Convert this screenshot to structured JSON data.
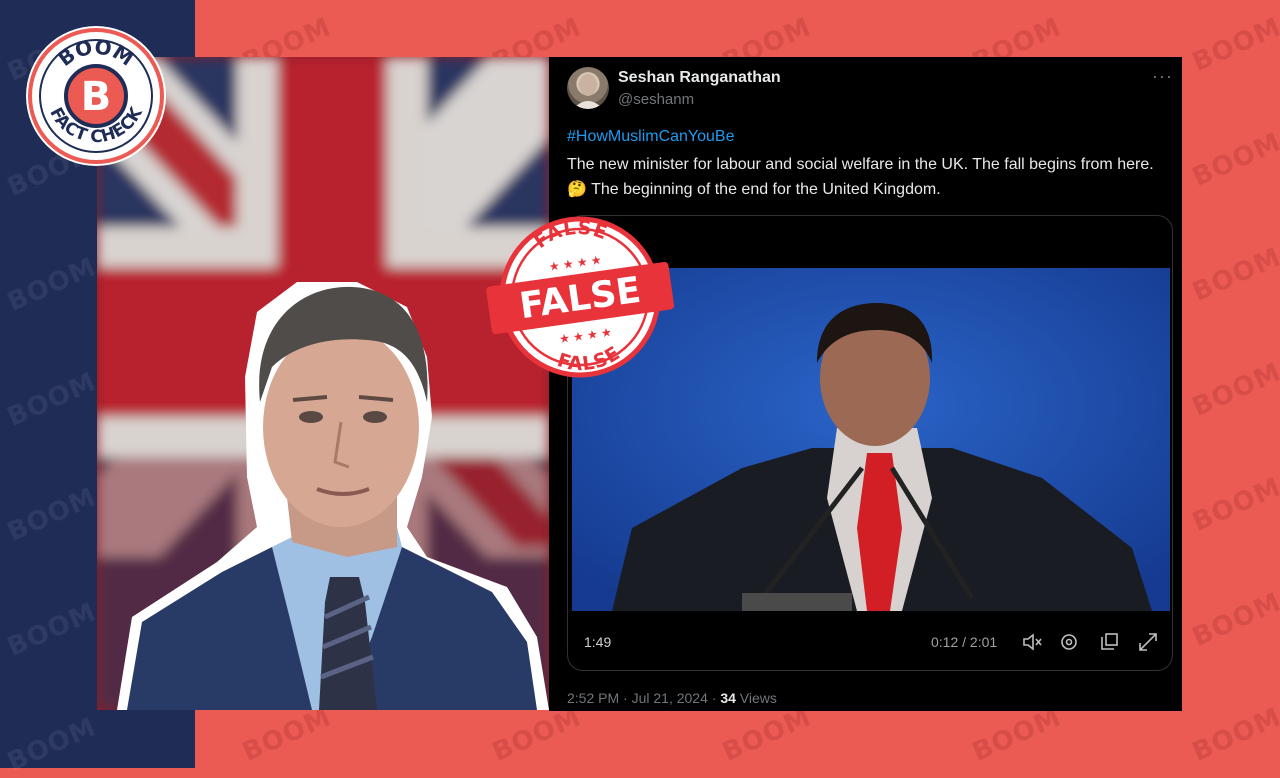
{
  "brand": {
    "logo_top": "BOOM",
    "logo_letter": "B",
    "logo_bottom": "FACT CHECK",
    "watermark": "BOOM",
    "accent": "#ec5a54",
    "navy": "#1f2c55"
  },
  "stamp": {
    "top": "FALSE",
    "center": "FALSE",
    "bottom": "FALSE",
    "color": "#e8333b"
  },
  "tweet": {
    "author_name": "Seshan Ranganathan",
    "author_handle": "@seshanm",
    "more_label": "···",
    "hashtag": "#HowMuslimCanYouBe",
    "text": "The new minister for labour and social welfare in the UK. The fall begins from here. 🤔 The beginning of the end for the United Kingdom.",
    "video": {
      "left_time": "1:49",
      "progress_time": "0:12 / 2:01",
      "icons": [
        "volume-mute-icon",
        "settings-icon",
        "popout-icon",
        "fullscreen-icon"
      ]
    },
    "timestamp": "2:52 PM · Jul 21, 2024 · ",
    "views_count": "34",
    "views_label": " Views"
  }
}
